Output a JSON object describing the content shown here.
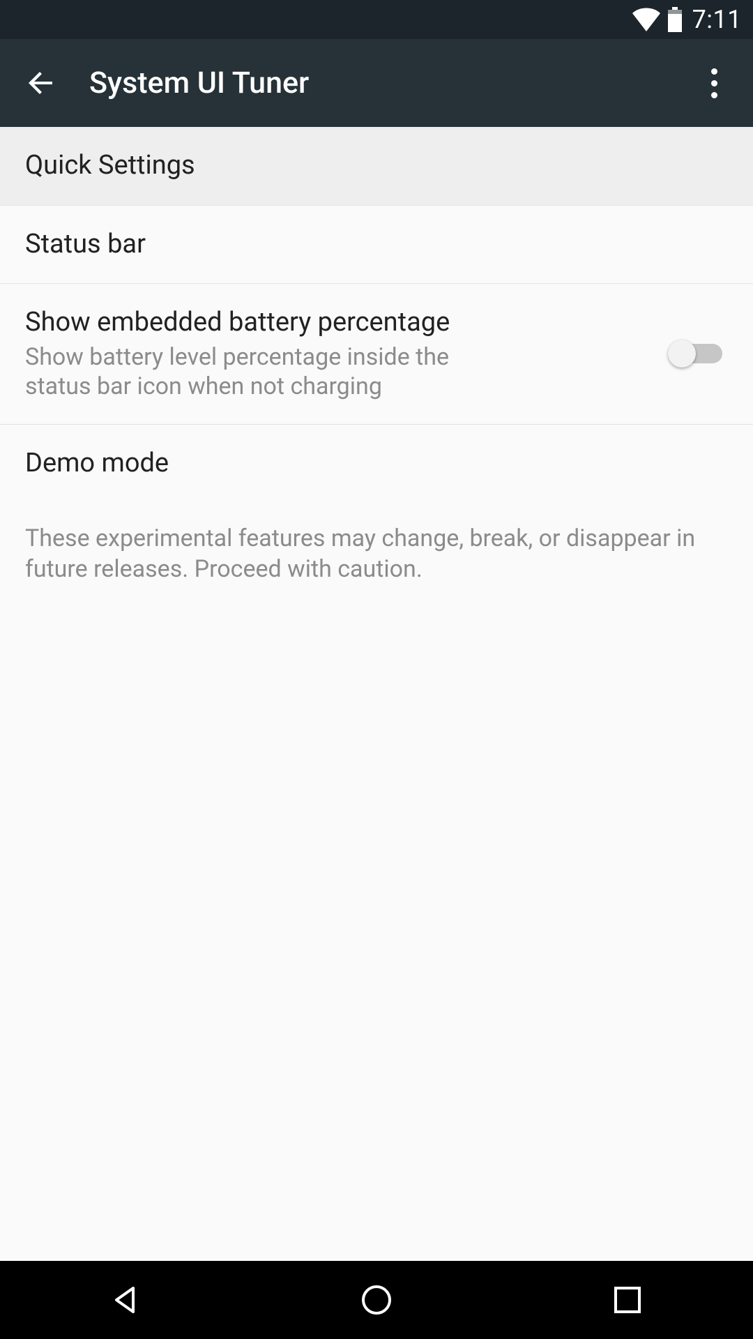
{
  "status_bar": {
    "clock": "7:11"
  },
  "app_bar": {
    "title": "System UI Tuner"
  },
  "items": {
    "quick_settings": {
      "title": "Quick Settings"
    },
    "status_bar": {
      "title": "Status bar"
    },
    "battery_percent": {
      "title": "Show embedded battery percentage",
      "sub": "Show battery level percentage inside the status bar icon when not charging",
      "on": false
    },
    "demo_mode": {
      "title": "Demo mode"
    }
  },
  "footer_note": "These experimental features may change, break, or disappear in future releases. Proceed with caution."
}
